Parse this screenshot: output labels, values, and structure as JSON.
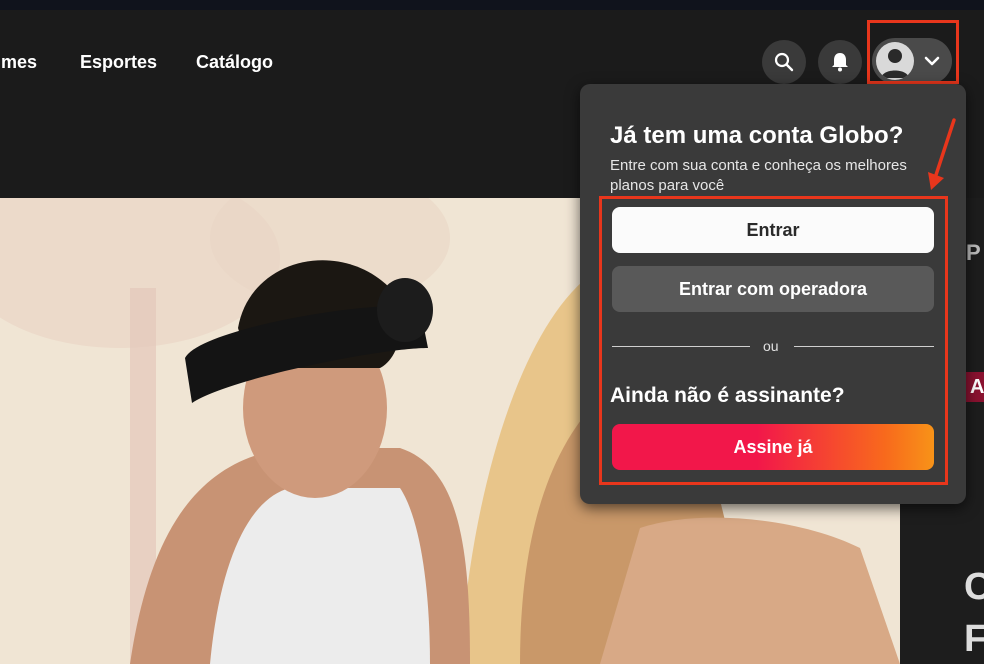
{
  "nav": {
    "items": [
      {
        "label": "lmes"
      },
      {
        "label": "Esportes"
      },
      {
        "label": "Catálogo"
      }
    ]
  },
  "header": {
    "icons": [
      "search-icon",
      "bell-icon",
      "user-avatar-icon",
      "chevron-down-icon"
    ]
  },
  "login_popup": {
    "title": "Já tem uma conta Globo?",
    "subtitle": "Entre com sua conta e conheça os melhores planos para você",
    "login_button": "Entrar",
    "operator_button": "Entrar com operadora",
    "or_label": "ou",
    "not_subscriber": "Ainda não é assinante?",
    "subscribe_button": "Assine já"
  },
  "right_strip": {
    "letters": [
      "P",
      "A",
      "C",
      "F"
    ]
  },
  "colors": {
    "highlight": "#e8361c",
    "cta_start": "#f2174a",
    "cta_end": "#f89318",
    "popup_bg": "#3a3a3a"
  }
}
